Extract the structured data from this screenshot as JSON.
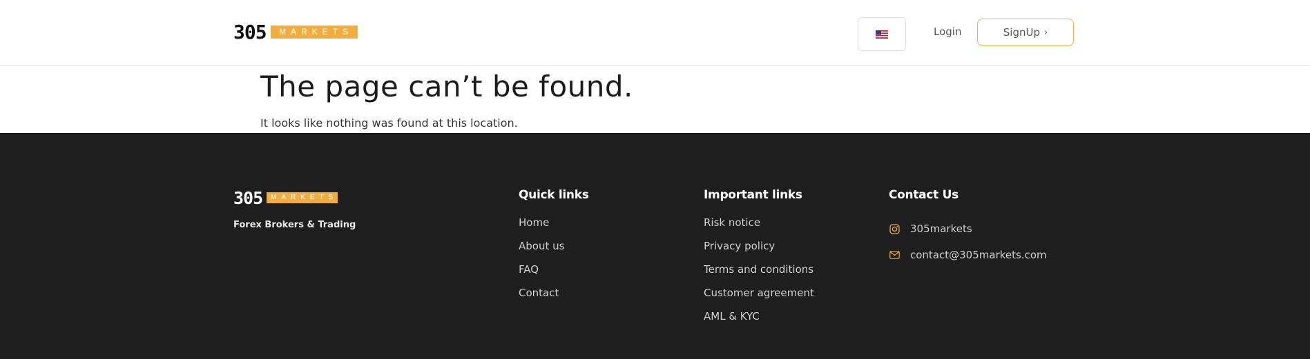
{
  "header": {
    "logo_digits": "305",
    "logo_word": "MARKETS",
    "language_icon": "us-flag-icon",
    "login_label": "Login",
    "signup_label": "SignUp",
    "signup_chevron": "›"
  },
  "main": {
    "title": "The page can’t be found.",
    "subtitle": "It looks like nothing was found at this location."
  },
  "footer": {
    "logo_digits": "305",
    "logo_word": "MARKETS",
    "tagline": "Forex Brokers & Trading",
    "quick_links": {
      "heading": "Quick links",
      "items": [
        "Home",
        "About us",
        "FAQ",
        "Contact"
      ]
    },
    "important_links": {
      "heading": "Important links",
      "items": [
        "Risk notice",
        "Privacy policy",
        "Terms and conditions",
        "Customer agreement",
        "AML & KYC"
      ]
    },
    "contact": {
      "heading": "Contact Us",
      "instagram_icon": "instagram-icon",
      "instagram": "305markets",
      "email_icon": "envelope-icon",
      "email": "contact@305markets.com"
    }
  },
  "colors": {
    "accent": "#f0ad40",
    "footer_bg": "#1e1e1e",
    "text_dark": "#1c1c1c"
  }
}
